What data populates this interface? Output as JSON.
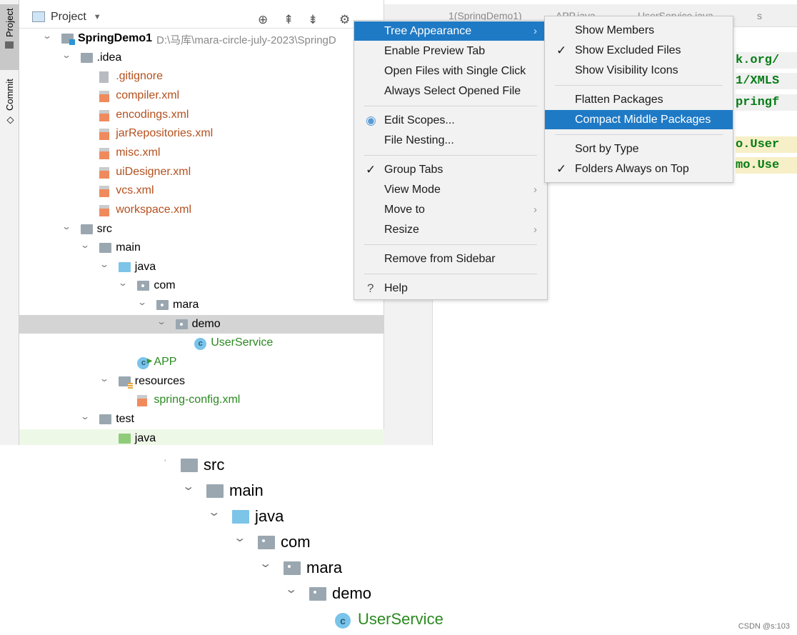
{
  "sidebar_tabs": {
    "project": "Project",
    "commit": "Commit"
  },
  "panel": {
    "title": "Project"
  },
  "tree": [
    {
      "label": "SpringDemo1",
      "path": "D:\\马库\\mara-circle-july-2023\\SpringD",
      "depth": 0,
      "icon": "module-folder",
      "expanded": true,
      "bold": true
    },
    {
      "label": ".idea",
      "depth": 1,
      "icon": "folder",
      "expanded": true
    },
    {
      "label": ".gitignore",
      "depth": 2,
      "icon": "ignored-file",
      "color": "#b4501e"
    },
    {
      "label": "compiler.xml",
      "depth": 2,
      "icon": "xml-file",
      "color": "#b4501e"
    },
    {
      "label": "encodings.xml",
      "depth": 2,
      "icon": "xml-file",
      "color": "#b4501e"
    },
    {
      "label": "jarRepositories.xml",
      "depth": 2,
      "icon": "xml-file",
      "color": "#b4501e"
    },
    {
      "label": "misc.xml",
      "depth": 2,
      "icon": "xml-file",
      "color": "#b4501e"
    },
    {
      "label": "uiDesigner.xml",
      "depth": 2,
      "icon": "xml-file",
      "color": "#b4501e"
    },
    {
      "label": "vcs.xml",
      "depth": 2,
      "icon": "xml-file",
      "color": "#b4501e"
    },
    {
      "label": "workspace.xml",
      "depth": 2,
      "icon": "xml-file",
      "color": "#b4501e"
    },
    {
      "label": "src",
      "depth": 1,
      "icon": "folder",
      "expanded": true
    },
    {
      "label": "main",
      "depth": 2,
      "icon": "folder",
      "expanded": true
    },
    {
      "label": "java",
      "depth": 3,
      "icon": "source-folder",
      "expanded": true
    },
    {
      "label": "com",
      "depth": 4,
      "icon": "package",
      "expanded": true
    },
    {
      "label": "mara",
      "depth": 5,
      "icon": "package",
      "expanded": true
    },
    {
      "label": "demo",
      "depth": 6,
      "icon": "package",
      "expanded": true,
      "selected": true
    },
    {
      "label": "UserService",
      "depth": 7,
      "icon": "class",
      "color": "#2a8a1f"
    },
    {
      "label": "APP",
      "depth": 4,
      "icon": "runnable-class",
      "color": "#2a8a1f"
    },
    {
      "label": "resources",
      "depth": 3,
      "icon": "resources-folder",
      "expanded": true
    },
    {
      "label": "spring-config.xml",
      "depth": 4,
      "icon": "xml-file",
      "color": "#2a8a1f"
    },
    {
      "label": "test",
      "depth": 2,
      "icon": "folder",
      "expanded": true
    },
    {
      "label": "java",
      "depth": 3,
      "icon": "test-folder",
      "highlighted": true
    }
  ],
  "editor_tabs": [
    "1(SpringDemo1)",
    "APP.java",
    "UserService.java",
    "s"
  ],
  "code_fragments": [
    {
      "text": "k.org/",
      "bg": "#f0f0f0"
    },
    {
      "text": "1/XMLS",
      "bg": "#f0f0f0"
    },
    {
      "text": "pringf",
      "bg": "#f0f0f0"
    },
    {
      "text": "o.User",
      "bg": "#f7efc7"
    },
    {
      "text": "mo.Use",
      "bg": "#f7efc7"
    }
  ],
  "menu": {
    "items": [
      {
        "label": "Tree Appearance",
        "submenu": true,
        "active": true
      },
      {
        "label": "Enable Preview Tab"
      },
      {
        "label": "Open Files with Single Click"
      },
      {
        "label": "Always Select Opened File"
      },
      {
        "sep": true
      },
      {
        "label": "Edit Scopes...",
        "icon": "radio-icon"
      },
      {
        "label": "File Nesting..."
      },
      {
        "sep": true
      },
      {
        "label": "Group Tabs",
        "checked": true
      },
      {
        "label": "View Mode",
        "submenu": true
      },
      {
        "label": "Move to",
        "submenu": true
      },
      {
        "label": "Resize",
        "submenu": true
      },
      {
        "sep": true
      },
      {
        "label": "Remove from Sidebar"
      },
      {
        "sep": true
      },
      {
        "label": "Help",
        "icon": "help-icon"
      }
    ]
  },
  "submenu": {
    "items": [
      {
        "label": "Show Members"
      },
      {
        "label": "Show Excluded Files",
        "checked": true
      },
      {
        "label": "Show Visibility Icons"
      },
      {
        "sep": true
      },
      {
        "label": "Flatten Packages"
      },
      {
        "label": "Compact Middle Packages",
        "active": true
      },
      {
        "sep": true
      },
      {
        "label": "Sort by Type"
      },
      {
        "label": "Folders Always on Top",
        "checked": true
      }
    ]
  },
  "zoomed_tree": [
    {
      "label": "src",
      "depth": 0,
      "icon": "folder"
    },
    {
      "label": "main",
      "depth": 1,
      "icon": "folder"
    },
    {
      "label": "java",
      "depth": 2,
      "icon": "source-folder"
    },
    {
      "label": "com",
      "depth": 3,
      "icon": "package"
    },
    {
      "label": "mara",
      "depth": 4,
      "icon": "package"
    },
    {
      "label": "demo",
      "depth": 5,
      "icon": "package"
    },
    {
      "label": "UserService",
      "depth": 6,
      "icon": "class",
      "color": "#2a8a1f"
    }
  ],
  "watermark": "CSDN @s:103"
}
